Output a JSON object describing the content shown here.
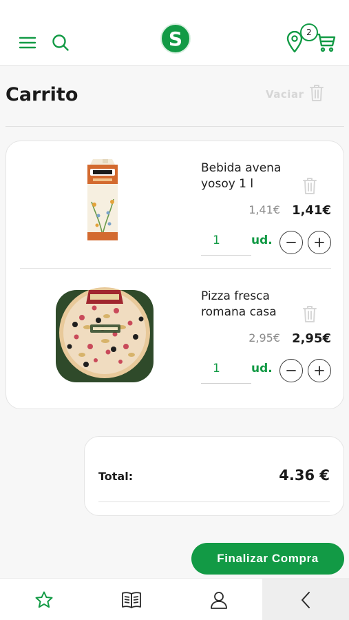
{
  "header": {
    "logo_letter": "S",
    "cart_count": "2"
  },
  "page": {
    "title": "Carrito",
    "clear_label": "Vaciar"
  },
  "cart": {
    "items": [
      {
        "name": "Bebida avena yosoy 1 l",
        "price_old": "1,41€",
        "price_new": "1,41€",
        "quantity": "1",
        "unit": "ud."
      },
      {
        "name": "Pizza fresca romana casa",
        "price_old": "2,95€",
        "price_new": "2,95€",
        "quantity": "1",
        "unit": "ud."
      }
    ]
  },
  "summary": {
    "total_label": "Total:",
    "total_value": "4.36 €"
  },
  "actions": {
    "checkout_label": "Finalizar Compra"
  },
  "nav": {
    "items": [
      "favorites-icon",
      "catalog-icon",
      "account-icon",
      "back-icon"
    ]
  },
  "colors": {
    "brand_green": "#129a45",
    "muted_text": "#8a8a8a",
    "disabled": "#d6d6d6"
  }
}
